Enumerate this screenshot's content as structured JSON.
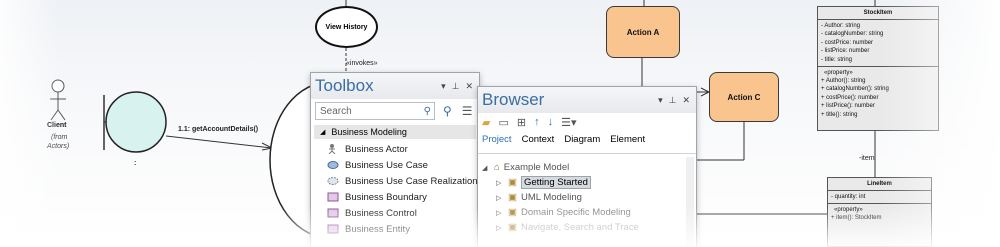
{
  "diagram": {
    "actor_label": "Client",
    "actor_note_1": "(from",
    "actor_note_2": "Actors)",
    "lifeline_colon": ":",
    "message_label": "1.1: getAccountDetails()",
    "history_label": "View History",
    "invokes_label": "«invokes»",
    "action_a": "Action A",
    "action_c": "Action C",
    "stockitem": {
      "title": "StockItem",
      "attributes": [
        "- Author: string",
        "- catalogNumber: string",
        "- costPrice: number",
        "- listPrice: number",
        "- title: string"
      ],
      "stereotype": "«property»",
      "operations": [
        "+ Author(): string",
        "+ catalogNumber(): string",
        "+ costPrice(): number",
        "+ listPrice(): number",
        "+ title(): string"
      ]
    },
    "item_role": "-item",
    "lineitem": {
      "title": "LineItem",
      "attributes": [
        "- quantity: int"
      ],
      "stereotype": "«property»",
      "operations": [
        "+ item(): StockItem"
      ]
    }
  },
  "toolbox": {
    "title": "Toolbox",
    "search_placeholder": "Search",
    "section": "Business Modeling",
    "items": [
      {
        "label": "Business Actor",
        "icon": "actor-icon"
      },
      {
        "label": "Business Use Case",
        "icon": "usecase-icon"
      },
      {
        "label": "Business Use Case Realization",
        "icon": "usecase-realization-icon"
      },
      {
        "label": "Business Boundary",
        "icon": "boundary-icon"
      },
      {
        "label": "Business Control",
        "icon": "control-icon"
      },
      {
        "label": "Business Entity",
        "icon": "entity-icon"
      }
    ]
  },
  "browser": {
    "title": "Browser",
    "tabs": [
      "Project",
      "Context",
      "Diagram",
      "Element"
    ],
    "active_tab": "Project",
    "root": "Example Model",
    "children": [
      "Getting Started",
      "UML Modeling",
      "Domain Specific Modeling",
      "Navigate, Search and Trace"
    ],
    "selected": "Getting Started"
  },
  "colors": {
    "action_fill": "#f9c48e",
    "lifeline_fill": "#d8f3ef",
    "accent": "#3a6ea5"
  }
}
